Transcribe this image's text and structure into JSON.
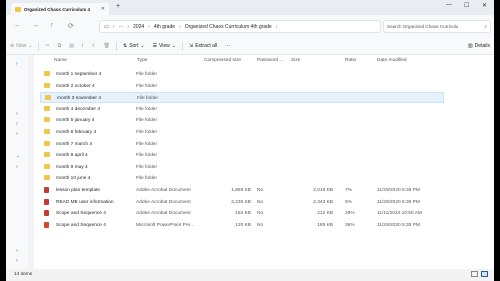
{
  "tab": {
    "title": "Organized Chaos Curriculum 4",
    "close": "✕"
  },
  "window_controls": {
    "min": "—",
    "max": "☐",
    "close": "✕"
  },
  "nav": {
    "back": "←",
    "forward": "→",
    "up": "↑",
    "refresh": "⟳"
  },
  "breadcrumb": {
    "root": "›",
    "ellipsis": "···",
    "items": [
      "2024",
      "4th grade",
      "Organized Chaos Curriculum 4th grade"
    ],
    "sep": "›"
  },
  "search": {
    "placeholder": "Search Organized Chaos Curriculu",
    "icon": "⌕"
  },
  "toolbar": {
    "new": "New",
    "sort": "Sort",
    "view": "View",
    "extract_all": "Extract all",
    "more": "···",
    "details": "Details"
  },
  "columns": [
    "Name",
    "Type",
    "Compressed size",
    "Password ...",
    "Size",
    "Ratio",
    "Date modified"
  ],
  "files": [
    {
      "icon": "folder",
      "name": "month 1 september 4",
      "type": "File folder",
      "comp": "",
      "pw": "",
      "size": "",
      "ratio": "",
      "date": ""
    },
    {
      "icon": "folder",
      "name": "month 2 october 4",
      "type": "File folder",
      "comp": "",
      "pw": "",
      "size": "",
      "ratio": "",
      "date": ""
    },
    {
      "icon": "folder",
      "name": "month 3 november 4",
      "type": "File folder",
      "comp": "",
      "pw": "",
      "size": "",
      "ratio": "",
      "date": "",
      "selected": true
    },
    {
      "icon": "folder",
      "name": "month 4 december 4",
      "type": "File folder",
      "comp": "",
      "pw": "",
      "size": "",
      "ratio": "",
      "date": ""
    },
    {
      "icon": "folder",
      "name": "month 5 january 4",
      "type": "File folder",
      "comp": "",
      "pw": "",
      "size": "",
      "ratio": "",
      "date": ""
    },
    {
      "icon": "folder",
      "name": "month 6 february 4",
      "type": "File folder",
      "comp": "",
      "pw": "",
      "size": "",
      "ratio": "",
      "date": ""
    },
    {
      "icon": "folder",
      "name": "month 7 march 4",
      "type": "File folder",
      "comp": "",
      "pw": "",
      "size": "",
      "ratio": "",
      "date": ""
    },
    {
      "icon": "folder",
      "name": "month 8 april 4",
      "type": "File folder",
      "comp": "",
      "pw": "",
      "size": "",
      "ratio": "",
      "date": ""
    },
    {
      "icon": "folder",
      "name": "month 9 may 4",
      "type": "File folder",
      "comp": "",
      "pw": "",
      "size": "",
      "ratio": "",
      "date": ""
    },
    {
      "icon": "folder",
      "name": "month 10 june 4",
      "type": "File folder",
      "comp": "",
      "pw": "",
      "size": "",
      "ratio": "",
      "date": ""
    },
    {
      "icon": "doc",
      "name": "lesson plan template",
      "type": "Adobe Acrobat Document",
      "comp": "1,886 KB",
      "pw": "No",
      "size": "2,018 KB",
      "ratio": "7%",
      "date": "11/29/2020 6:36 PM"
    },
    {
      "icon": "doc",
      "name": "READ ME user information",
      "type": "Adobe Acrobat Document",
      "comp": "2,236 KB",
      "pw": "No",
      "size": "2,343 KB",
      "ratio": "5%",
      "date": "11/29/2020 6:36 PM"
    },
    {
      "icon": "doc",
      "name": "Scope and Sequence 4",
      "type": "Adobe Acrobat Document",
      "comp": "152 KB",
      "pw": "No",
      "size": "212 KB",
      "ratio": "29%",
      "date": "11/11/2024 10:50 AM"
    },
    {
      "icon": "ppt",
      "name": "Scope and Sequence 4",
      "type": "Microsoft PowerPoint Pre...",
      "comp": "120 KB",
      "pw": "No",
      "size": "185 KB",
      "ratio": "36%",
      "date": "11/29/2020 5:35 PM"
    }
  ],
  "status": {
    "count": "14 items"
  },
  "accent": "#2a5a9a",
  "selection_color": "#e5f1fb"
}
